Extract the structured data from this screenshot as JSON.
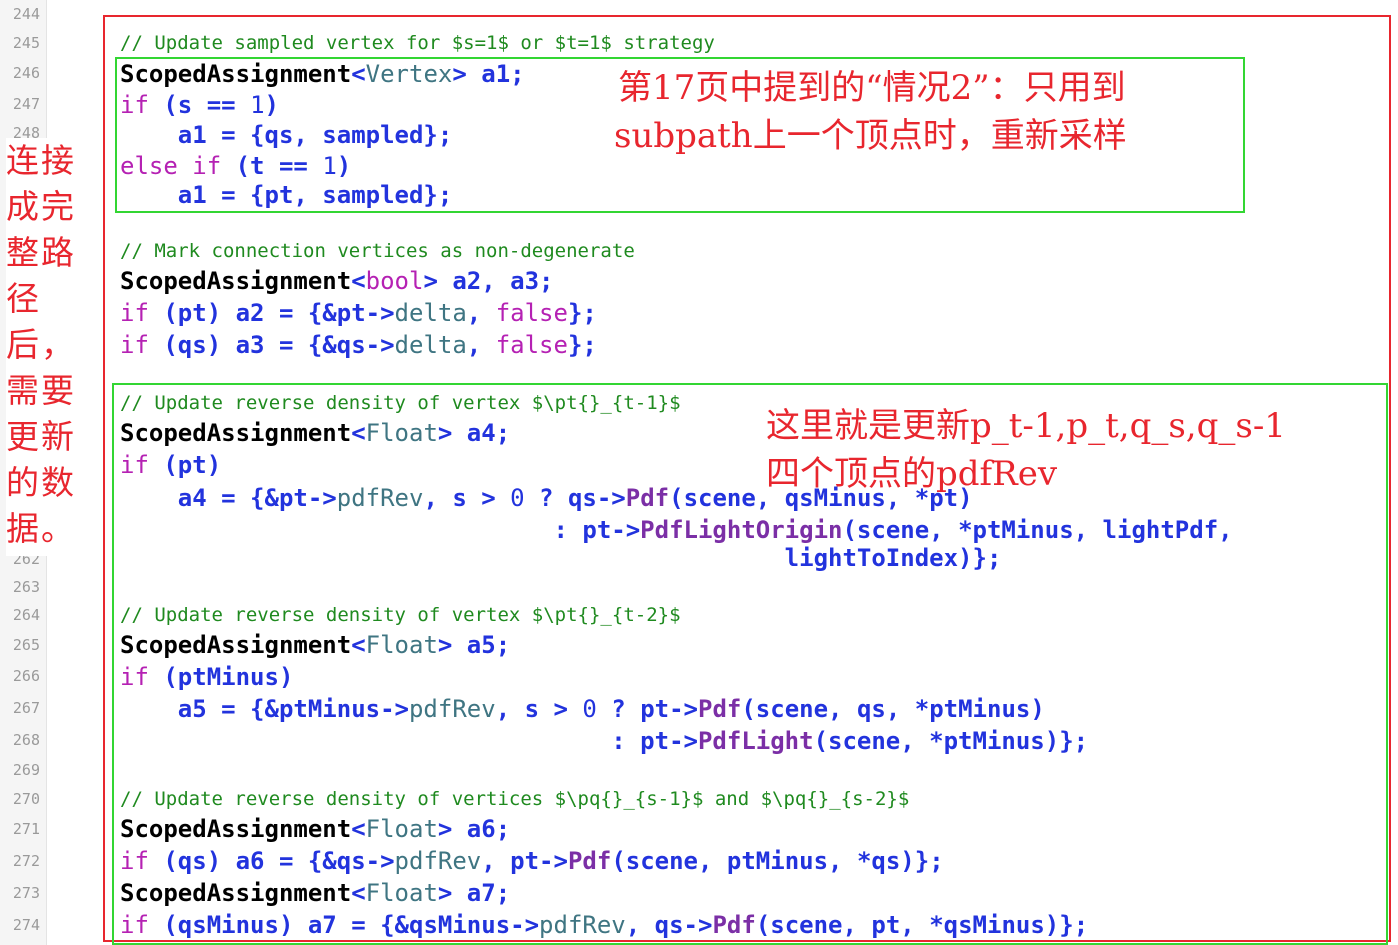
{
  "gutter": {
    "line_numbers": [
      "244",
      "245",
      "246",
      "247",
      "248",
      "262",
      "263",
      "264",
      "265",
      "266",
      "267",
      "268",
      "269",
      "270",
      "271",
      "272",
      "273",
      "274"
    ]
  },
  "code": {
    "lines": [
      {
        "kind": "comment",
        "tokens": [
          {
            "t": "// Update sampled vertex for $s=1$ or $t=1$ strategy",
            "c": "comment"
          }
        ]
      },
      {
        "kind": "code",
        "tokens": [
          {
            "t": "ScopedAssignment",
            "c": "type"
          },
          {
            "t": "<",
            "c": "op"
          },
          {
            "t": "Vertex",
            "c": "cls"
          },
          {
            "t": "> a1;",
            "c": "var"
          }
        ]
      },
      {
        "kind": "code",
        "tokens": [
          {
            "t": "if",
            "c": "kw"
          },
          {
            "t": " (s == ",
            "c": "var"
          },
          {
            "t": "1",
            "c": "num"
          },
          {
            "t": ")",
            "c": "var"
          }
        ]
      },
      {
        "kind": "code",
        "tokens": [
          {
            "t": "    a1 = {qs, sampled};",
            "c": "var"
          }
        ]
      },
      {
        "kind": "code",
        "tokens": [
          {
            "t": "else if",
            "c": "kw"
          },
          {
            "t": " (t == ",
            "c": "var"
          },
          {
            "t": "1",
            "c": "num"
          },
          {
            "t": ")",
            "c": "var"
          }
        ]
      },
      {
        "kind": "code",
        "tokens": [
          {
            "t": "    a1 = {pt, sampled};",
            "c": "var"
          }
        ]
      },
      {
        "kind": "blank",
        "tokens": []
      },
      {
        "kind": "comment",
        "tokens": [
          {
            "t": "// Mark connection vertices as non-degenerate",
            "c": "comment"
          }
        ]
      },
      {
        "kind": "code",
        "tokens": [
          {
            "t": "ScopedAssignment",
            "c": "type"
          },
          {
            "t": "<",
            "c": "op"
          },
          {
            "t": "bool",
            "c": "kw"
          },
          {
            "t": "> a2, a3;",
            "c": "var"
          }
        ]
      },
      {
        "kind": "code",
        "tokens": [
          {
            "t": "if",
            "c": "kw"
          },
          {
            "t": " (pt) a2 = {&pt->",
            "c": "var"
          },
          {
            "t": "delta",
            "c": "prop"
          },
          {
            "t": ", ",
            "c": "var"
          },
          {
            "t": "false",
            "c": "kw"
          },
          {
            "t": "};",
            "c": "var"
          }
        ]
      },
      {
        "kind": "code",
        "tokens": [
          {
            "t": "if",
            "c": "kw"
          },
          {
            "t": " (qs) a3 = {&qs->",
            "c": "var"
          },
          {
            "t": "delta",
            "c": "prop"
          },
          {
            "t": ", ",
            "c": "var"
          },
          {
            "t": "false",
            "c": "kw"
          },
          {
            "t": "};",
            "c": "var"
          }
        ]
      },
      {
        "kind": "blank",
        "tokens": []
      },
      {
        "kind": "comment",
        "tokens": [
          {
            "t": "// Update reverse density of vertex $\\pt{}_{t-1}$",
            "c": "comment"
          }
        ]
      },
      {
        "kind": "code",
        "tokens": [
          {
            "t": "ScopedAssignment",
            "c": "type"
          },
          {
            "t": "<",
            "c": "op"
          },
          {
            "t": "Float",
            "c": "cls"
          },
          {
            "t": "> a4;",
            "c": "var"
          }
        ]
      },
      {
        "kind": "code",
        "tokens": [
          {
            "t": "if",
            "c": "kw"
          },
          {
            "t": " (pt)",
            "c": "var"
          }
        ]
      },
      {
        "kind": "code",
        "tokens": [
          {
            "t": "    a4 = {&pt->",
            "c": "var"
          },
          {
            "t": "pdfRev",
            "c": "prop"
          },
          {
            "t": ", s > ",
            "c": "var"
          },
          {
            "t": "0",
            "c": "num"
          },
          {
            "t": " ? qs->",
            "c": "var"
          },
          {
            "t": "Pdf",
            "c": "fn"
          },
          {
            "t": "(scene, qsMinus, *pt)",
            "c": "var"
          }
        ]
      },
      {
        "kind": "code",
        "tokens": [
          {
            "t": "                              : pt->",
            "c": "var"
          },
          {
            "t": "PdfLightOrigin",
            "c": "fn"
          },
          {
            "t": "(scene, *ptMinus, lightPdf,",
            "c": "var"
          }
        ]
      },
      {
        "kind": "code",
        "tokens": [
          {
            "t": "                                              lightToIndex)};",
            "c": "var"
          }
        ]
      },
      {
        "kind": "blank",
        "tokens": []
      },
      {
        "kind": "comment",
        "tokens": [
          {
            "t": "// Update reverse density of vertex $\\pt{}_{t-2}$",
            "c": "comment"
          }
        ]
      },
      {
        "kind": "code",
        "tokens": [
          {
            "t": "ScopedAssignment",
            "c": "type"
          },
          {
            "t": "<",
            "c": "op"
          },
          {
            "t": "Float",
            "c": "cls"
          },
          {
            "t": "> a5;",
            "c": "var"
          }
        ]
      },
      {
        "kind": "code",
        "tokens": [
          {
            "t": "if",
            "c": "kw"
          },
          {
            "t": " (ptMinus)",
            "c": "var"
          }
        ]
      },
      {
        "kind": "code",
        "tokens": [
          {
            "t": "    a5 = {&ptMinus->",
            "c": "var"
          },
          {
            "t": "pdfRev",
            "c": "prop"
          },
          {
            "t": ", s > ",
            "c": "var"
          },
          {
            "t": "0",
            "c": "num"
          },
          {
            "t": " ? pt->",
            "c": "var"
          },
          {
            "t": "Pdf",
            "c": "fn"
          },
          {
            "t": "(scene, qs, *ptMinus)",
            "c": "var"
          }
        ]
      },
      {
        "kind": "code",
        "tokens": [
          {
            "t": "                                  : pt->",
            "c": "var"
          },
          {
            "t": "PdfLight",
            "c": "fn"
          },
          {
            "t": "(scene, *ptMinus)};",
            "c": "var"
          }
        ]
      },
      {
        "kind": "blank",
        "tokens": []
      },
      {
        "kind": "comment",
        "tokens": [
          {
            "t": "// Update reverse density of vertices $\\pq{}_{s-1}$ and $\\pq{}_{s-2}$",
            "c": "comment"
          }
        ]
      },
      {
        "kind": "code",
        "tokens": [
          {
            "t": "ScopedAssignment",
            "c": "type"
          },
          {
            "t": "<",
            "c": "op"
          },
          {
            "t": "Float",
            "c": "cls"
          },
          {
            "t": "> a6;",
            "c": "var"
          }
        ]
      },
      {
        "kind": "code",
        "tokens": [
          {
            "t": "if",
            "c": "kw"
          },
          {
            "t": " (qs) a6 = {&qs->",
            "c": "var"
          },
          {
            "t": "pdfRev",
            "c": "prop"
          },
          {
            "t": ", pt->",
            "c": "var"
          },
          {
            "t": "Pdf",
            "c": "fn"
          },
          {
            "t": "(scene, ptMinus, *qs)};",
            "c": "var"
          }
        ]
      },
      {
        "kind": "code",
        "tokens": [
          {
            "t": "ScopedAssignment",
            "c": "type"
          },
          {
            "t": "<",
            "c": "op"
          },
          {
            "t": "Float",
            "c": "cls"
          },
          {
            "t": "> a7;",
            "c": "var"
          }
        ]
      },
      {
        "kind": "code",
        "tokens": [
          {
            "t": "if",
            "c": "kw"
          },
          {
            "t": " (qsMinus) a7 = {&qsMinus->",
            "c": "var"
          },
          {
            "t": "pdfRev",
            "c": "prop"
          },
          {
            "t": ", qs->",
            "c": "var"
          },
          {
            "t": "Pdf",
            "c": "fn"
          },
          {
            "t": "(scene, pt, *qsMinus)};",
            "c": "var"
          }
        ]
      }
    ]
  },
  "annotations": {
    "box1_text": [
      "第17页中提到的“情况2”：只用到",
      "subpath上一个顶点时，重新采样"
    ],
    "box2_text": [
      "这里就是更新p_t-1,p_t,q_s,q_s-1",
      "四个顶点的pdfRev"
    ],
    "left_text": [
      "连接",
      "成完",
      "整路",
      "径",
      "后，",
      "需要",
      "更新",
      "的数",
      "据。"
    ]
  },
  "colors": {
    "annotation_red": "#e8262e",
    "box_green": "#33d633",
    "comment_green": "#1f8a1f",
    "keyword_magenta": "#b521b3",
    "variable_blue": "#2233dd",
    "class_teal": "#3f7582",
    "function_purple": "#7b2fa6"
  }
}
